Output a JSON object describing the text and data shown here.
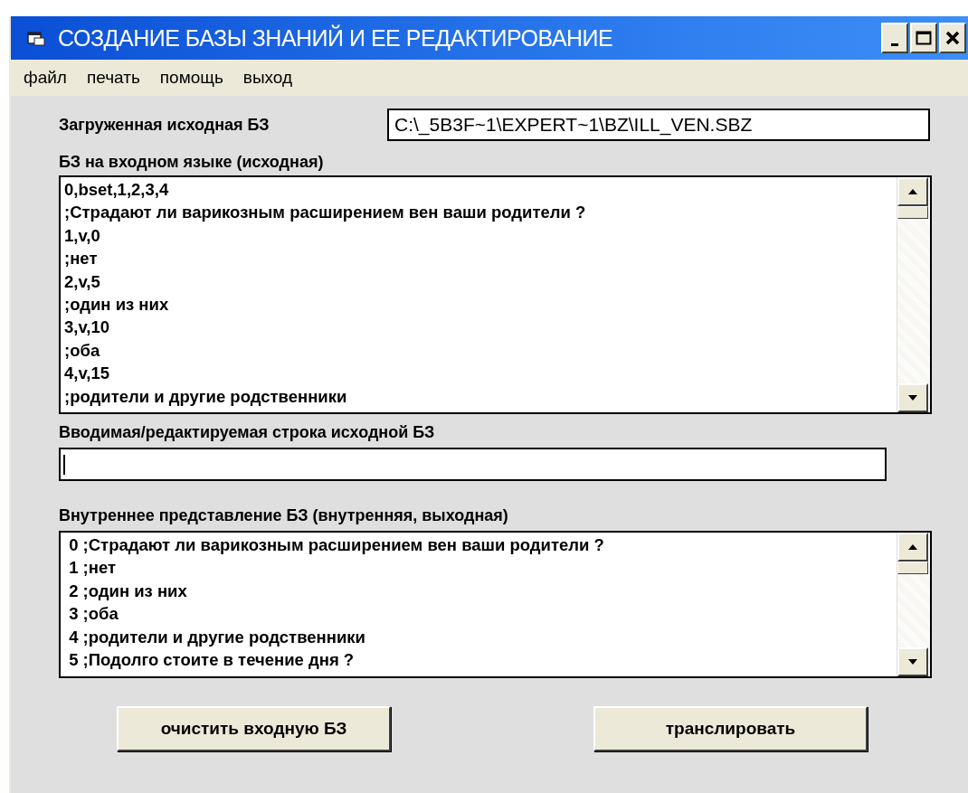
{
  "window": {
    "title": "СОЗДАНИЕ БАЗЫ ЗНАНИЙ И ЕЕ РЕДАКТИРОВАНИЕ"
  },
  "menu": [
    "файл",
    "печать",
    "помощь",
    "выход"
  ],
  "loaded_kb": {
    "label": "Загруженная исходная БЗ",
    "value": "C:\\_5B3F~1\\EXPERT~1\\BZ\\ILL_VEN.SBZ"
  },
  "source_list": {
    "label": "БЗ на входном языке (исходная)",
    "lines": [
      "0,bset,1,2,3,4",
      ";Страдают ли варикозным расширением вен ваши родители ?",
      "1,v,0",
      ";нет",
      "2,v,5",
      ";один из них",
      "3,v,10",
      ";оба",
      "4,v,15",
      ";родители и другие родственники"
    ]
  },
  "edit_line": {
    "label": "Вводимая/редактируемая строка исходной БЗ"
  },
  "internal_list": {
    "label": "Внутреннее представление БЗ (внутренняя, выходная)",
    "lines": [
      " 0 ;Страдают ли варикозным расширением вен ваши родители ?",
      " 1 ;нет",
      " 2 ;один из них",
      " 3 ;оба",
      " 4 ;родители и другие родственники",
      " 5 ;Подолго стоите в течение дня ?"
    ]
  },
  "buttons": [
    "очистить входную БЗ",
    "транслировать"
  ]
}
